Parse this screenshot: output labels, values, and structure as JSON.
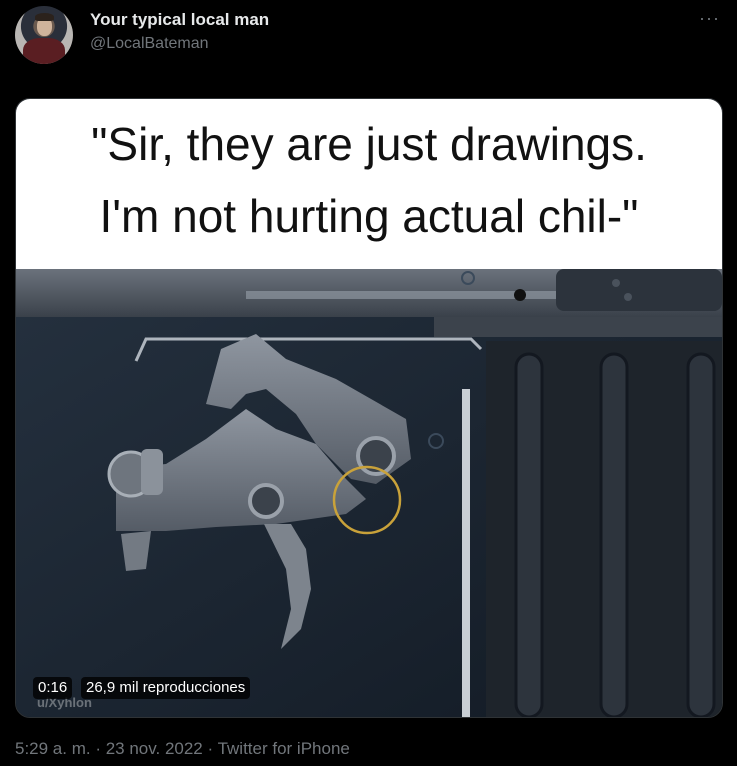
{
  "tweet": {
    "display_name": "Your typical local man",
    "handle": "@LocalBateman",
    "more_label": "···",
    "media": {
      "caption_line1": "\"Sir, they are just drawings.",
      "caption_line2": "I'm not hurting actual chil-\"",
      "duration": "0:16",
      "views": "26,9 mil reproducciones",
      "watermark": "u/Xyhlon"
    },
    "time": "5:29 a. m.",
    "separator1": " · ",
    "date": "23 nov. 2022",
    "separator2": " · ",
    "source": "Twitter for iPhone"
  }
}
